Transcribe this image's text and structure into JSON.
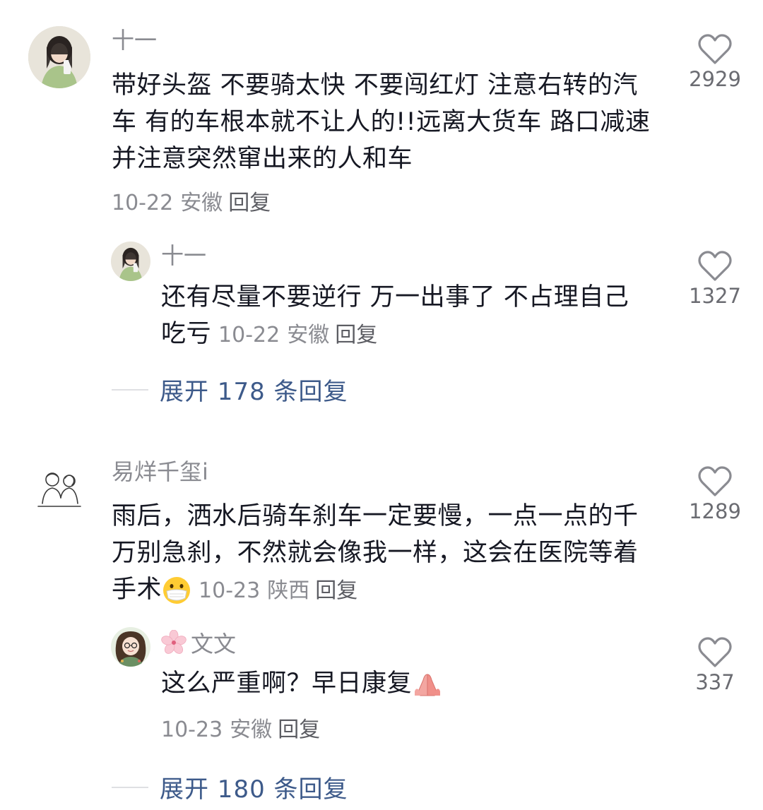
{
  "comments": [
    {
      "username": "十一",
      "text": "带好头盔 不要骑太快 不要闯红灯 注意右转的汽车 有的车根本就不让人的!!远离大货车 路口减速并注意突然窜出来的人和车",
      "date": "10-22",
      "location": "安徽",
      "reply_label": "回复",
      "likes": "2929",
      "avatar_icon": "girl-photo-avatar",
      "reply": {
        "username": "十一",
        "text": "还有尽量不要逆行 万一出事了 不占理自己吃亏",
        "date": "10-22",
        "location": "安徽",
        "reply_label": "回复",
        "likes": "1327",
        "avatar_icon": "girl-photo-avatar"
      },
      "expand_label": "展开 178 条回复"
    },
    {
      "username": "易烊千玺i",
      "text": "雨后，洒水后骑车刹车一定要慢，一点一点的千万别急刹，不然就会像我一样，这会在医院等着手术",
      "emoji": "mask-face-emoji",
      "date": "10-23",
      "location": "陕西",
      "reply_label": "回复",
      "likes": "1289",
      "avatar_icon": "sketch-couple-avatar",
      "reply": {
        "username_prefix_icon": "cherry-blossom-emoji",
        "username": "文文",
        "text": "这么严重啊？早日康复",
        "emoji": "praying-hands-emoji",
        "date": "10-23",
        "location": "安徽",
        "reply_label": "回复",
        "likes": "337",
        "avatar_icon": "cartoon-girl-avatar"
      },
      "expand_label": "展开 180 条回复"
    }
  ],
  "colors": {
    "text": "#161823",
    "muted": "#8a8b91",
    "link": "#3d5a8a",
    "divider": "#dfe0e3"
  }
}
